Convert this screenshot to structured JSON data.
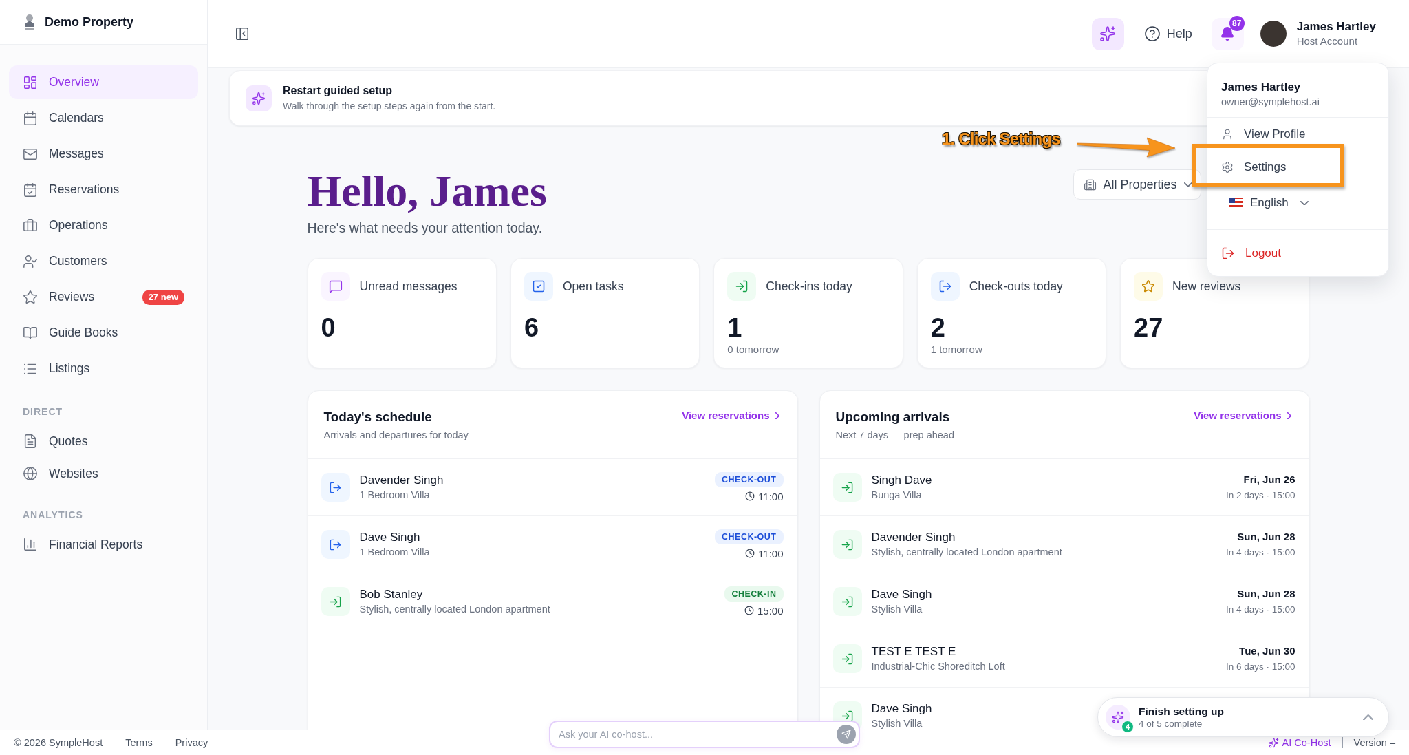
{
  "sidebar": {
    "brand": "Demo Property",
    "groups": [
      {
        "items": [
          {
            "label": "Overview",
            "selected": true
          },
          {
            "label": "Calendars",
            "selected": false
          },
          {
            "label": "Messages",
            "selected": false
          },
          {
            "label": "Reservations",
            "selected": false
          },
          {
            "label": "Operations",
            "selected": false
          },
          {
            "label": "Customers",
            "selected": false
          },
          {
            "label": "Reviews",
            "selected": false,
            "badge": "27 new"
          },
          {
            "label": "Guide Books",
            "selected": false
          },
          {
            "label": "Listings",
            "selected": false
          }
        ]
      },
      {
        "heading": "DIRECT",
        "items": [
          {
            "label": "Quotes",
            "selected": false
          },
          {
            "label": "Websites",
            "selected": false
          }
        ]
      },
      {
        "heading": "ANALYTICS",
        "items": [
          {
            "label": "Financial Reports",
            "selected": false
          }
        ]
      }
    ]
  },
  "topbar": {
    "help": "Help",
    "notifications": "87",
    "user": {
      "name": "James Hartley",
      "role": "Host Account"
    }
  },
  "account_menu": {
    "name": "James Hartley",
    "email": "owner@symplehost.ai",
    "items": [
      {
        "label": "View Profile"
      },
      {
        "label": "Settings"
      }
    ],
    "language": "English",
    "logout": "Logout"
  },
  "annotation": {
    "text": "1. Click Settings"
  },
  "banner": {
    "title": "Restart guided setup",
    "subtitle": "Walk through the setup steps again from the start."
  },
  "greeting": {
    "title": "Hello, James",
    "subtitle": "Here's what needs your attention today.",
    "filter": "All Properties"
  },
  "stats": [
    {
      "kind": "messages",
      "label": "Unread messages",
      "value": "0"
    },
    {
      "kind": "tasks",
      "label": "Open tasks",
      "value": "6"
    },
    {
      "kind": "check-in",
      "label": "Check-ins today",
      "value": "1",
      "note": "0 tomorrow"
    },
    {
      "kind": "check-out",
      "label": "Check-outs today",
      "value": "2",
      "note": "1 tomorrow"
    },
    {
      "kind": "reviews",
      "label": "New reviews",
      "value": "27"
    }
  ],
  "schedule": {
    "title": "Today's schedule",
    "subtitle": "Arrivals and departures for today",
    "link": "View reservations",
    "rows": [
      {
        "kind": "check-out",
        "name": "Davender Singh",
        "property": "1 Bedroom Villa",
        "status": "CHECK-OUT",
        "time": "11:00"
      },
      {
        "kind": "check-out",
        "name": "Dave Singh",
        "property": "1 Bedroom Villa",
        "status": "CHECK-OUT",
        "time": "11:00"
      },
      {
        "kind": "check-in",
        "name": "Bob Stanley",
        "property": "Stylish, centrally located London apartment",
        "status": "CHECK-IN",
        "time": "15:00"
      }
    ]
  },
  "arrivals": {
    "title": "Upcoming arrivals",
    "subtitle": "Next 7 days — prep ahead",
    "link": "View reservations",
    "rows": [
      {
        "name": "Singh Dave",
        "property": "Bunga Villa",
        "date": "Fri, Jun 26",
        "when": "In 2 days · 15:00"
      },
      {
        "name": "Davender Singh",
        "property": "Stylish, centrally located London apartment",
        "date": "Sun, Jun 28",
        "when": "In 4 days · 15:00"
      },
      {
        "name": "Dave Singh",
        "property": "Stylish Villa",
        "date": "Sun, Jun 28",
        "when": "In 4 days · 15:00"
      },
      {
        "name": "TEST E TEST E",
        "property": "Industrial-Chic Shoreditch Loft",
        "date": "Tue, Jun 30",
        "when": "In 6 days · 15:00"
      },
      {
        "name": "Dave Singh",
        "property": "Stylish Villa"
      }
    ]
  },
  "setup_widget": {
    "title": "Finish setting up",
    "progress": "4 of 5 complete",
    "badge": "4"
  },
  "chat": {
    "placeholder": "Ask your AI co-host..."
  },
  "footer": {
    "copyright": "© 2026 SympleHost",
    "links": [
      "Terms",
      "Privacy"
    ],
    "ai_link": "AI Co-Host",
    "version": "Version –"
  }
}
